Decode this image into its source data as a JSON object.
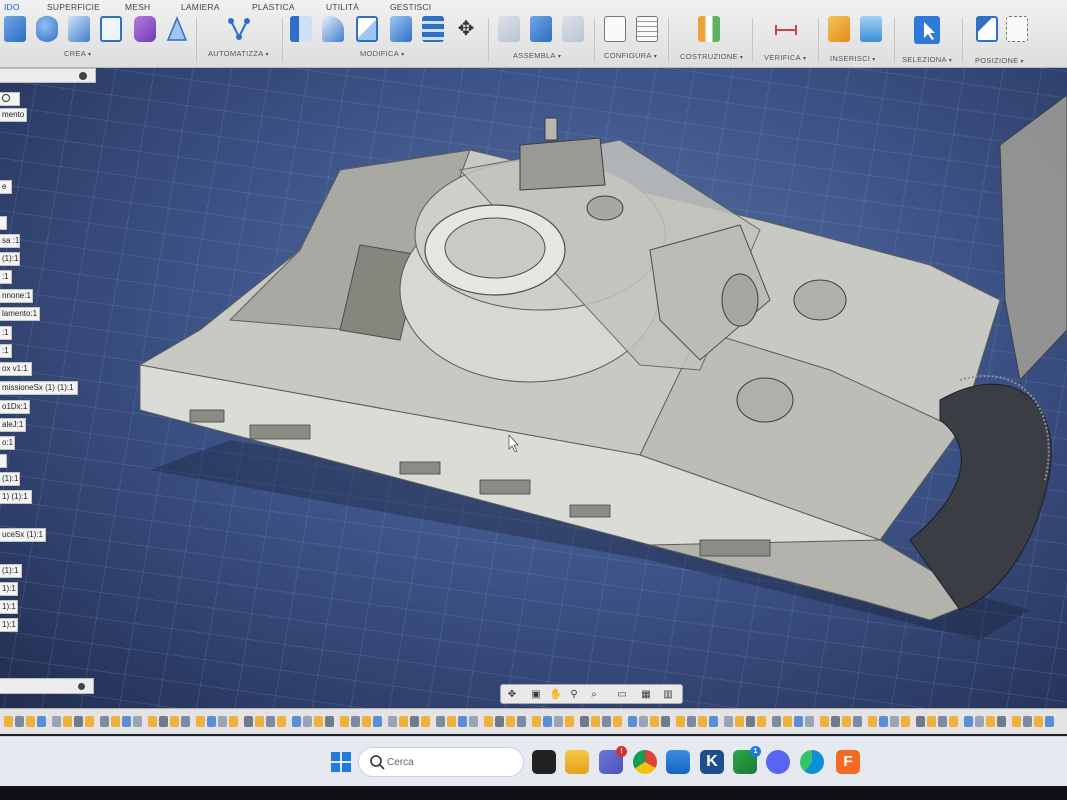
{
  "toolbar": {
    "tabs": [
      {
        "label": "IDO",
        "active": true
      },
      {
        "label": "SUPERFICIE"
      },
      {
        "label": "MESH"
      },
      {
        "label": "LAMIERA"
      },
      {
        "label": "PLASTICA"
      },
      {
        "label": "UTILITÀ"
      },
      {
        "label": "GESTISCI"
      }
    ],
    "groups": {
      "crea": "CREA",
      "automatizza": "AUTOMATIZZA",
      "modifica": "MODIFICA",
      "assembla": "ASSEMBLA",
      "configura": "CONFIGURA",
      "costruzione": "COSTRUZIONE",
      "verifica": "VERIFICA",
      "inserisci": "INSERISCI",
      "seleziona": "SELEZIONA",
      "posizione": "POSIZIONE"
    },
    "caret": "▾"
  },
  "browser": {
    "items": [
      "mento",
      "e",
      "sa :1",
      "(1):1",
      ":1",
      "nnone:1",
      "lamento:1",
      ":1",
      ":1",
      "ox v1:1",
      "missioneSx (1) (1):1",
      "o1Dx:1",
      "aleJ:1",
      "o:1",
      "(1):1",
      "1) (1):1",
      "uceSx (1):1",
      "(1):1",
      "1):1",
      "1):1",
      "1):1"
    ]
  },
  "taskbar": {
    "search_placeholder": "Cerca",
    "teams_badge": "!",
    "xbox_badge": "1"
  },
  "colors": {
    "accent": "#0a64d2",
    "viewport": "#3e5488",
    "model": "#c9c9c4",
    "fusion": "#f26b21"
  }
}
